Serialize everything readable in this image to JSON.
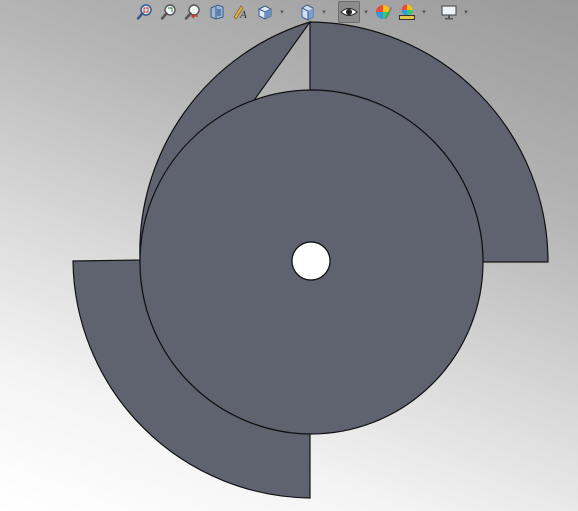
{
  "toolbar": {
    "buttons": [
      {
        "name": "zoom-to-fit-icon"
      },
      {
        "name": "zoom-to-area-icon"
      },
      {
        "name": "previous-view-icon"
      },
      {
        "name": "section-view-icon"
      },
      {
        "name": "dynamic-annotation-views-icon"
      },
      {
        "name": "view-orientation-icon",
        "dropdown": true
      },
      {
        "name": "display-style-icon",
        "dropdown": true
      },
      {
        "name": "hide-show-items-icon",
        "dropdown": true,
        "active": true
      },
      {
        "name": "edit-appearance-icon"
      },
      {
        "name": "apply-scene-icon",
        "dropdown": true
      },
      {
        "name": "view-settings-icon",
        "dropdown": true
      }
    ],
    "dropdown_glyph": "▾"
  },
  "model": {
    "face_color": "#5f6370",
    "edge_color": "#111111",
    "hole_color": "#ffffff"
  }
}
